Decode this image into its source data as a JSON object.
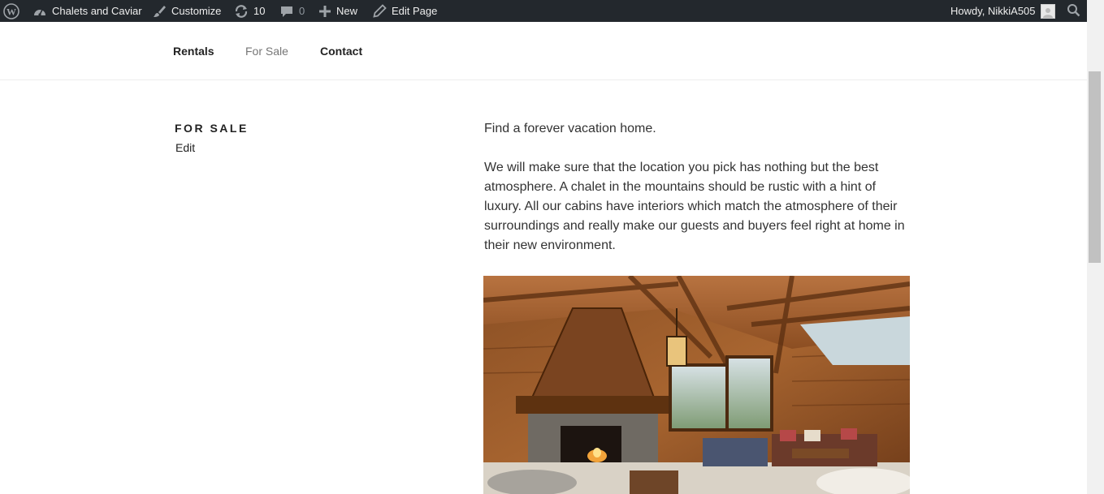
{
  "adminbar": {
    "site_name": "Chalets and Caviar",
    "customize": "Customize",
    "updates_count": "10",
    "comments_count": "0",
    "new_label": "New",
    "edit_page": "Edit Page",
    "howdy": "Howdy, NikkiA505"
  },
  "nav": {
    "items": [
      {
        "label": "Rentals"
      },
      {
        "label": "For Sale"
      },
      {
        "label": "Contact"
      }
    ]
  },
  "page": {
    "title": "FOR SALE",
    "edit": "Edit",
    "paragraphs": [
      "Find a forever vacation home.",
      "We will make sure that the location you pick has nothing but the best atmosphere. A chalet in the mountains should be rustic with a hint of luxury. All our cabins have interiors which match the atmosphere of their surroundings and really make our guests and buyers feel right at home in their new environment."
    ]
  },
  "colors": {
    "adminbar_bg": "#23282d",
    "adminbar_text": "#eeeeee",
    "nav_current": "#767676",
    "body_text": "#333333"
  },
  "icons": [
    "wordpress-icon",
    "dashboard-icon",
    "brush-icon",
    "updates-icon",
    "comment-icon",
    "plus-icon",
    "pencil-icon",
    "avatar-icon",
    "search-icon"
  ]
}
